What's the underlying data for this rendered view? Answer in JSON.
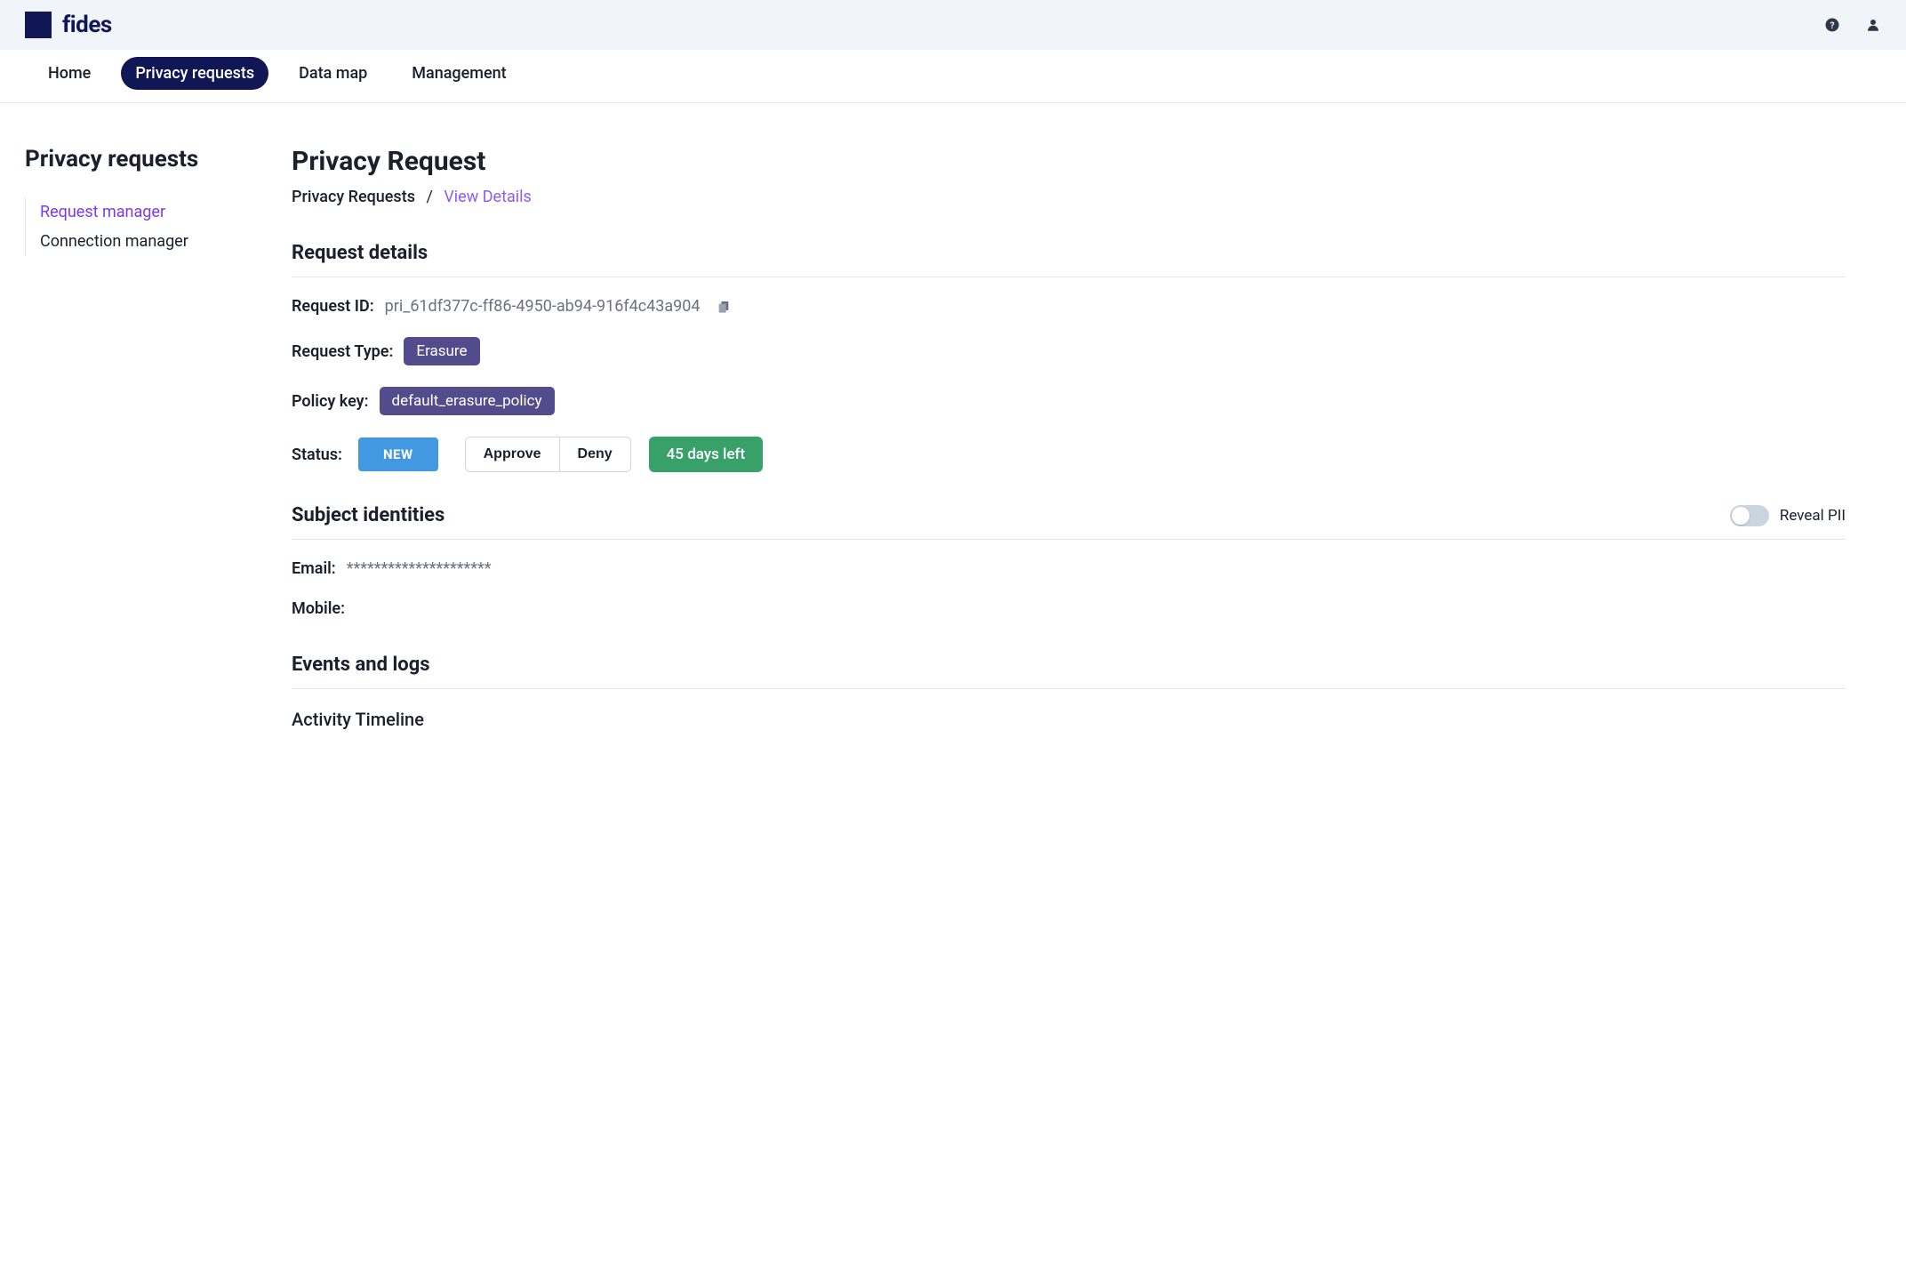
{
  "header": {
    "brand": "fides"
  },
  "nav": {
    "items": [
      {
        "label": "Home",
        "active": false
      },
      {
        "label": "Privacy requests",
        "active": true
      },
      {
        "label": "Data map",
        "active": false
      },
      {
        "label": "Management",
        "active": false
      }
    ]
  },
  "sidebar": {
    "title": "Privacy requests",
    "links": [
      {
        "label": "Request manager",
        "active": true
      },
      {
        "label": "Connection manager",
        "active": false
      }
    ]
  },
  "page": {
    "title": "Privacy Request",
    "breadcrumb": {
      "root": "Privacy Requests",
      "current": "View Details"
    }
  },
  "request_details": {
    "section_title": "Request details",
    "id_label": "Request ID:",
    "id_value": "pri_61df377c-ff86-4950-ab94-916f4c43a904",
    "type_label": "Request Type:",
    "type_value": "Erasure",
    "policy_label": "Policy key:",
    "policy_value": "default_erasure_policy",
    "status_label": "Status:",
    "status_value": "NEW",
    "approve_label": "Approve",
    "deny_label": "Deny",
    "days_left": "45 days left"
  },
  "subject_identities": {
    "section_title": "Subject identities",
    "reveal_label": "Reveal PII",
    "email_label": "Email:",
    "email_value": "*********************",
    "mobile_label": "Mobile:",
    "mobile_value": ""
  },
  "events": {
    "section_title": "Events and logs",
    "activity_title": "Activity Timeline"
  }
}
